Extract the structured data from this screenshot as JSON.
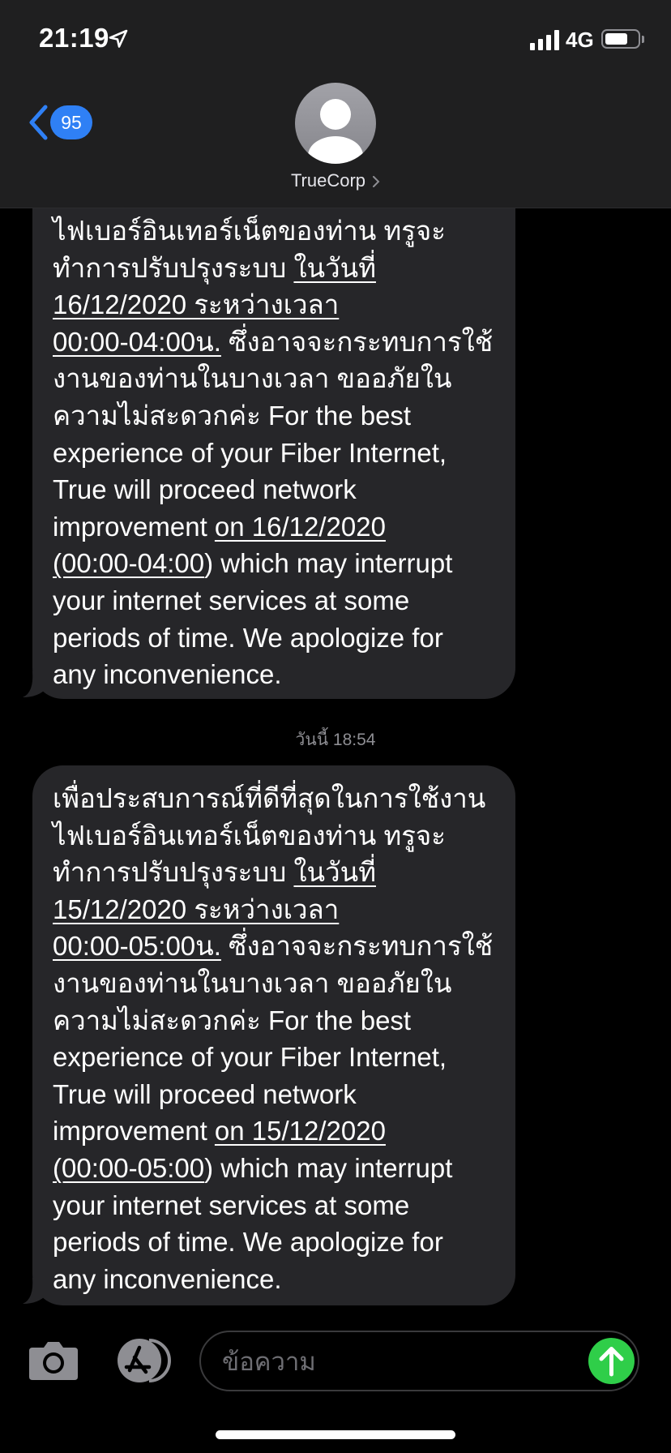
{
  "status_bar": {
    "time": "21:19",
    "network": "4G",
    "icons": [
      "location-arrow-icon",
      "signal-bars-icon",
      "battery-icon"
    ],
    "battery_level": 0.7
  },
  "header": {
    "back_badge": "95",
    "contact_name": "TrueCorp",
    "icons": [
      "back-chevron-icon",
      "avatar-person-icon",
      "chevron-right-icon"
    ]
  },
  "messages": [
    {
      "lines": [
        [
          "ไฟเบอร์อินเทอร์เน็ตของท่าน ทรูจะ"
        ],
        [
          "ทำการปรับปรุงระบบ ",
          {
            "u": "ในวันที่"
          }
        ],
        [
          {
            "u": "16/12/2020 ระหว่างเวลา"
          }
        ],
        [
          {
            "u": "00:00-04:00น."
          },
          " ซึ่งอาจจะกระทบการใช้"
        ],
        [
          "งานของท่านในบางเวลา ขออภัยใน"
        ],
        [
          "ความไม่สะดวกค่ะ For the best"
        ],
        [
          "experience of your Fiber Internet,"
        ],
        [
          "True will proceed network"
        ],
        [
          "improvement ",
          {
            "u": "on 16/12/2020"
          }
        ],
        [
          {
            "u": "(00:00-04:00"
          },
          ") which may interrupt"
        ],
        [
          "your internet services at some"
        ],
        [
          "periods of time.  We apologize for"
        ],
        [
          "any inconvenience."
        ]
      ]
    },
    {
      "lines": [
        [
          "เพื่อประสบการณ์ที่ดีที่สุดในการใช้งาน"
        ],
        [
          "ไฟเบอร์อินเทอร์เน็ตของท่าน ทรูจะ"
        ],
        [
          "ทำการปรับปรุงระบบ ",
          {
            "u": "ในวันที่"
          }
        ],
        [
          {
            "u": "15/12/2020 ระหว่างเวลา"
          }
        ],
        [
          {
            "u": "00:00-05:00น."
          },
          " ซึ่งอาจจะกระทบการใช้"
        ],
        [
          "งานของท่านในบางเวลา ขออภัยใน"
        ],
        [
          "ความไม่สะดวกค่ะ For the best"
        ],
        [
          "experience of your Fiber Internet,"
        ],
        [
          "True will proceed network"
        ],
        [
          "improvement ",
          {
            "u": "on 15/12/2020"
          }
        ],
        [
          {
            "u": "(00:00-05:00"
          },
          ") which may interrupt"
        ],
        [
          "your internet services at some"
        ],
        [
          "periods of time.  We apologize for"
        ],
        [
          "any inconvenience."
        ]
      ]
    }
  ],
  "timestamp": "วันนี้ 18:54",
  "compose": {
    "placeholder": "ข้อความ",
    "icons": [
      "camera-icon",
      "app-store-icon",
      "send-arrow-icon"
    ]
  },
  "colors": {
    "accent": "#2f80f5",
    "send": "#2fce49",
    "bubble": "#262629",
    "header": "#1f1f20"
  }
}
